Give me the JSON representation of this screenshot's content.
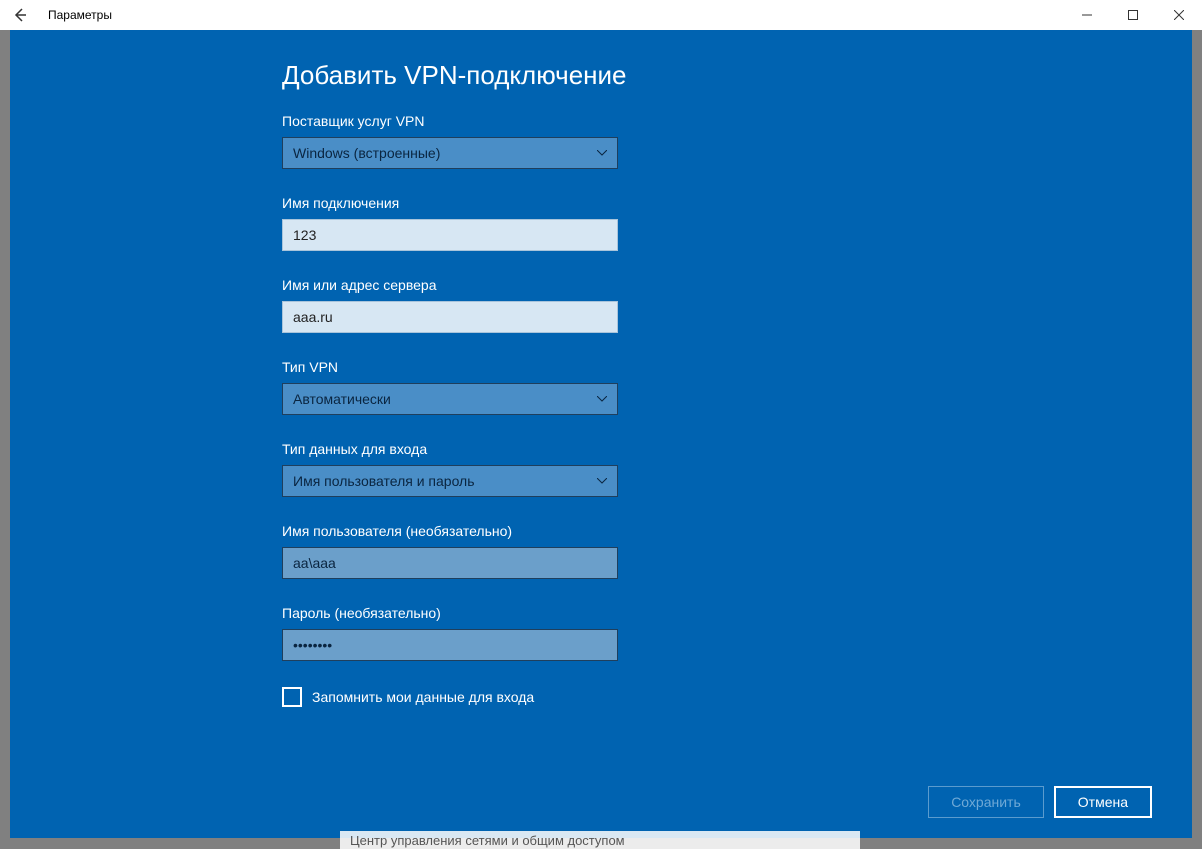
{
  "window": {
    "title": "Параметры"
  },
  "page": {
    "title": "Добавить VPN-подключение"
  },
  "fields": {
    "provider": {
      "label": "Поставщик услуг VPN",
      "value": "Windows (встроенные)"
    },
    "connectionName": {
      "label": "Имя подключения",
      "value": "123"
    },
    "serverAddress": {
      "label": "Имя или адрес сервера",
      "value": "aaa.ru"
    },
    "vpnType": {
      "label": "Тип VPN",
      "value": "Автоматически"
    },
    "signinType": {
      "label": "Тип данных для входа",
      "value": "Имя пользователя и пароль"
    },
    "username": {
      "label": "Имя пользователя (необязательно)",
      "value": "aa\\aaa"
    },
    "password": {
      "label": "Пароль (необязательно)",
      "value": "••••••••"
    },
    "remember": {
      "label": "Запомнить мои данные для входа"
    }
  },
  "buttons": {
    "save": "Сохранить",
    "cancel": "Отмена"
  },
  "footer": {
    "text": "Центр управления сетями и общим доступом"
  }
}
